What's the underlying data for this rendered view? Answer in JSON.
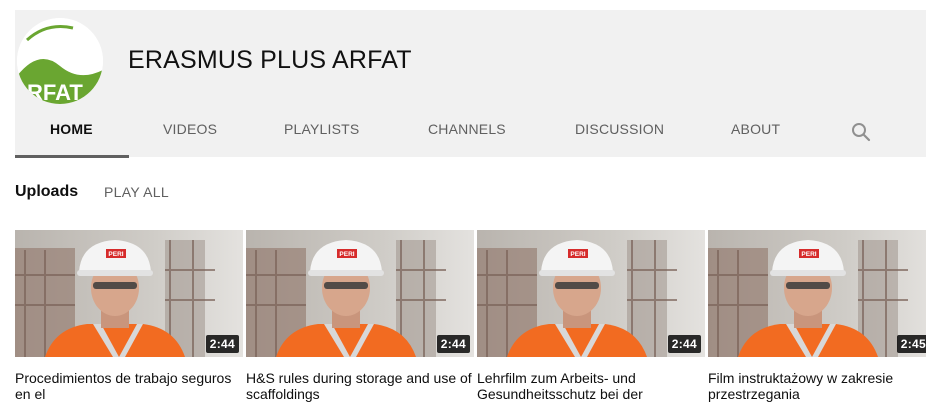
{
  "channel": {
    "title": "ERASMUS PLUS ARFAT",
    "logo_text": "RFAT",
    "logo_colors": [
      "#6aa631",
      "#ffffff"
    ]
  },
  "tabs": [
    {
      "label": "HOME",
      "active": true
    },
    {
      "label": "VIDEOS",
      "active": false
    },
    {
      "label": "PLAYLISTS",
      "active": false
    },
    {
      "label": "CHANNELS",
      "active": false
    },
    {
      "label": "DISCUSSION",
      "active": false
    },
    {
      "label": "ABOUT",
      "active": false
    }
  ],
  "tab_search_icon": "search-icon",
  "section": {
    "title": "Uploads",
    "play_all": "PLAY ALL"
  },
  "videos": [
    {
      "title": "Procedimientos de trabajo seguros en el",
      "duration": "2:44"
    },
    {
      "title": "H&S rules during storage and use of scaffoldings",
      "duration": "2:44"
    },
    {
      "title": "Lehrfilm zum Arbeits- und Gesundheitsschutz bei der",
      "duration": "2:44"
    },
    {
      "title": "Film instruktażowy w zakresie przestrzegania",
      "duration": "2:45"
    }
  ],
  "thumbnail": {
    "helmet_logo": "PERI",
    "vest_color": "#f26b21",
    "helmet_color": "#f4f4f4"
  }
}
